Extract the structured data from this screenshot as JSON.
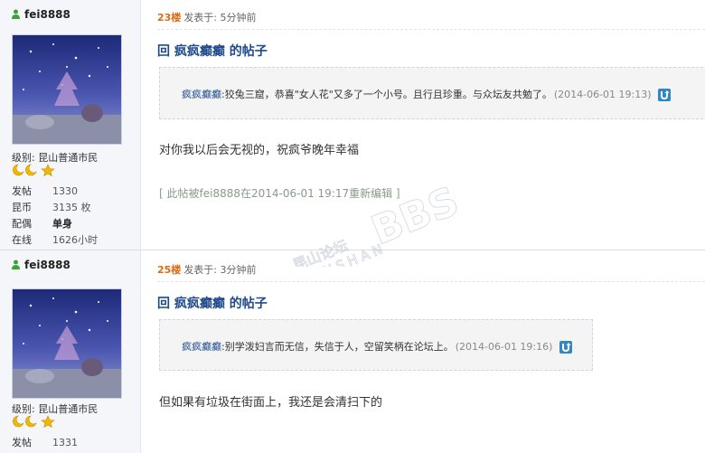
{
  "posts": [
    {
      "username": "fei8888",
      "level_label": "级别: 昆山普通市民",
      "stats": [
        {
          "key": "发帖",
          "value": "1330",
          "bold": false
        },
        {
          "key": "昆币",
          "value": "3135 枚",
          "bold": false
        },
        {
          "key": "配偶",
          "value": "单身",
          "bold": true
        },
        {
          "key": "在线",
          "value": "1626小时",
          "bold": false
        }
      ],
      "floor": "23楼",
      "posted_at": "发表于: 5分钟前",
      "title": "回 疯疯癫癫 的帖子",
      "quote": {
        "author": "疯疯癫癫",
        "text": ":狡兔三窟，恭喜\"女人花\"又多了一个小号。且行且珍重。与众坛友共勉了。",
        "date": "(2014-06-01 19:13)"
      },
      "body": "对你我以后会无视的，祝疯爷晚年幸福",
      "edit_note": "[ 此帖被fei8888在2014-06-01 19:17重新编辑 ]"
    },
    {
      "username": "fei8888",
      "level_label": "级别: 昆山普通市民",
      "stats": [
        {
          "key": "发帖",
          "value": "1331",
          "bold": false
        }
      ],
      "floor": "25楼",
      "posted_at": "发表于: 3分钟前",
      "title": "回 疯疯癫癫 的帖子",
      "quote": {
        "author": "疯疯癫癫",
        "text": ":别学泼妇言而无信，失信于人，空留笑柄在论坛上。",
        "date": "(2014-06-01 19:16)"
      },
      "body": "但如果有垃圾在街面上，我还是会清扫下的"
    }
  ],
  "watermark": {
    "cn": "昆山论坛",
    "en": "KUNSHAN",
    "bbs": "BBS"
  },
  "colors": {
    "title": "#1e4a8c",
    "floor": "#e06a14",
    "sidebar_bg": "#f4f6fa",
    "star": "#f2b800",
    "moon": "#f2b800"
  },
  "icons": {
    "user": "user-online-icon",
    "reply": "reply-arrow-icon"
  }
}
